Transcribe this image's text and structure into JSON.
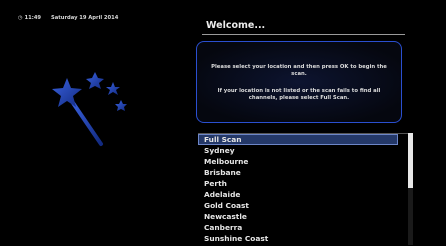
{
  "status_bar": {
    "time": "11:49",
    "date": "Saturday 19 April 2014"
  },
  "header": {
    "title": "Welcome..."
  },
  "info": {
    "paragraph1": "Please select your location and then press OK to begin the scan.",
    "paragraph2": "If your location is not listed or the scan fails to find all channels, please select Full Scan."
  },
  "location_list": {
    "items": [
      {
        "label": "Full Scan"
      },
      {
        "label": "Sydney"
      },
      {
        "label": "Melbourne"
      },
      {
        "label": "Brisbane"
      },
      {
        "label": "Perth"
      },
      {
        "label": "Adelaide"
      },
      {
        "label": "Gold Coast"
      },
      {
        "label": "Newcastle"
      },
      {
        "label": "Canberra"
      },
      {
        "label": "Sunshine Coast"
      }
    ],
    "selected_index": 0,
    "scroll_position_fraction": 0.5
  },
  "icons": {
    "clock": "clock-icon",
    "wizard": "magic-wand-icon"
  },
  "colors": {
    "background": "#000000",
    "accent_border": "#2a4fd0",
    "selection": "#243868",
    "wand_blue": "#1e3fa8"
  }
}
